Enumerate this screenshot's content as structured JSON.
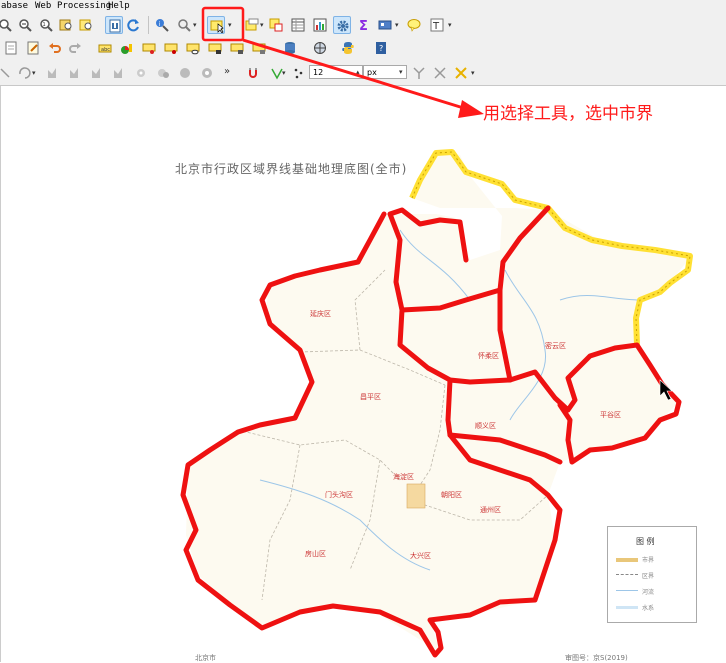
{
  "menu": {
    "items": [
      "abase",
      "Web",
      "Processing",
      "Help"
    ]
  },
  "toolbar3": {
    "font_size_value": "12",
    "unit_value": "px"
  },
  "map": {
    "title": "北京市行政区域界线基础地理底图(全市)",
    "districts": [
      "延庆区",
      "怀柔区",
      "密云区",
      "平谷区",
      "门头沟区",
      "昌平区",
      "顺义区",
      "海淀区",
      "朝阳区",
      "房山区",
      "大兴区",
      "通州区"
    ],
    "legend_title": "图  例",
    "legend_items": [
      "市界",
      "区界",
      "河流",
      "水系"
    ],
    "bottom_texts": [
      "北京市",
      "审图号：京S(2019)"
    ]
  },
  "annotation": {
    "text": "用选择工具，选中市界"
  },
  "colors": {
    "accent_red": "#ff1a1a",
    "selection_yellow": "#ffe033",
    "boundary_red": "#ee1111",
    "map_fill": "#fdfaf0",
    "selected_tool_bg": "#cde6fb"
  }
}
